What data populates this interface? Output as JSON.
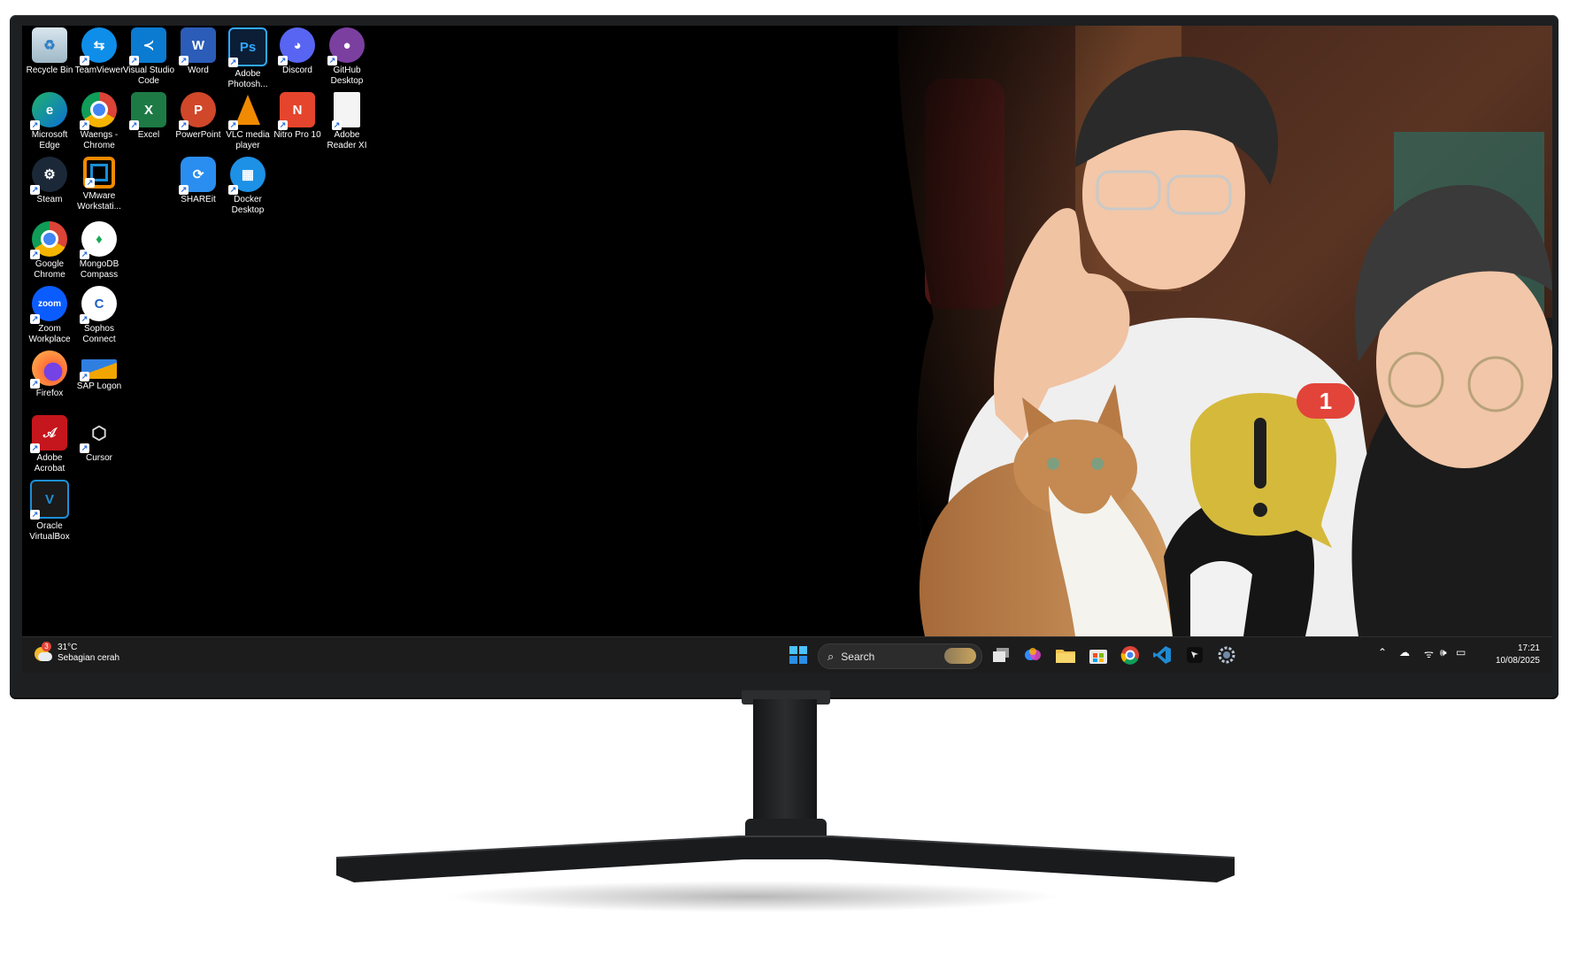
{
  "desktop": {
    "icons": [
      {
        "label": "Recycle Bin",
        "icon": "recycle-bin-icon"
      },
      {
        "label": "TeamViewer",
        "icon": "teamviewer-icon"
      },
      {
        "label": "Visual Studio Code",
        "icon": "vscode-icon"
      },
      {
        "label": "Word",
        "icon": "word-icon"
      },
      {
        "label": "Adobe Photosh...",
        "icon": "photoshop-icon"
      },
      {
        "label": "Discord",
        "icon": "discord-icon"
      },
      {
        "label": "GitHub Desktop",
        "icon": "github-icon"
      },
      {
        "label": "Microsoft Edge",
        "icon": "edge-icon"
      },
      {
        "label": "Waengs - Chrome",
        "icon": "chrome-profile-icon"
      },
      {
        "label": "Excel",
        "icon": "excel-icon"
      },
      {
        "label": "PowerPoint",
        "icon": "powerpoint-icon"
      },
      {
        "label": "VLC media player",
        "icon": "vlc-icon"
      },
      {
        "label": "Nitro Pro 10",
        "icon": "nitro-icon"
      },
      {
        "label": "Adobe Reader XI",
        "icon": "adobe-reader-icon"
      },
      {
        "label": "Steam",
        "icon": "steam-icon"
      },
      {
        "label": "VMware Workstati...",
        "icon": "vmware-icon"
      },
      {
        "label": "SHAREit",
        "icon": "shareit-icon"
      },
      {
        "label": "Docker Desktop",
        "icon": "docker-icon"
      },
      {
        "label": "Google Chrome",
        "icon": "chrome-icon"
      },
      {
        "label": "MongoDB Compass",
        "icon": "mongodb-icon"
      },
      {
        "label": "Zoom Workplace",
        "icon": "zoom-icon"
      },
      {
        "label": "Sophos Connect",
        "icon": "sophos-icon"
      },
      {
        "label": "Firefox",
        "icon": "firefox-icon"
      },
      {
        "label": "SAP Logon",
        "icon": "sap-icon"
      },
      {
        "label": "Adobe Acrobat",
        "icon": "acrobat-icon"
      },
      {
        "label": "Cursor",
        "icon": "cursor-icon"
      },
      {
        "label": "Oracle VirtualBox",
        "icon": "virtualbox-icon"
      }
    ],
    "wallpaper": {
      "notification_count": "1"
    }
  },
  "taskbar": {
    "weather": {
      "badge": "3",
      "temperature": "31°C",
      "condition": "Sebagian cerah"
    },
    "search_placeholder": "Search",
    "pinned": [
      "start-icon",
      "task-view-icon",
      "copilot-icon",
      "file-explorer-icon",
      "microsoft-store-icon",
      "chrome-icon",
      "vscode-icon",
      "cursor-icon",
      "settings-icon"
    ],
    "time": "17:21",
    "date": "10/08/2025"
  },
  "colors": {
    "taskbar": "#1c1c1c",
    "screen_bg": "#000000",
    "bezel": "#1d1f21",
    "bubble": "#d5b93b",
    "badge": "#e2443a"
  }
}
